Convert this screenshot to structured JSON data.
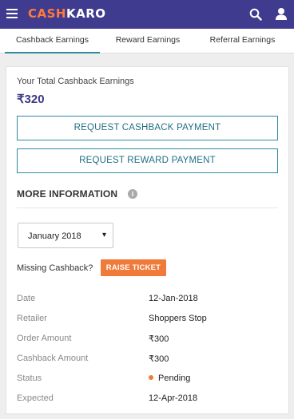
{
  "header": {
    "logo_part1": "CASH",
    "logo_part2": "KARO",
    "menu_icon": "hamburger-menu-icon",
    "search_icon": "search-icon",
    "user_icon": "user-icon"
  },
  "tabs": [
    {
      "label": "Cashback Earnings",
      "active": true
    },
    {
      "label": "Reward Earnings",
      "active": false
    },
    {
      "label": "Referral Earnings",
      "active": false
    }
  ],
  "summary": {
    "label": "Your Total Cashback Earnings",
    "amount": "₹320"
  },
  "buttons": {
    "request_cashback": "REQUEST CASHBACK PAYMENT",
    "request_reward": "REQUEST REWARD PAYMENT"
  },
  "more_info": {
    "title": "MORE INFORMATION",
    "icon": "i"
  },
  "month_select": {
    "value": "January 2018",
    "caret": "▾"
  },
  "missing": {
    "label": "Missing Cashback?",
    "button": "RAISE TICKET"
  },
  "details": [
    {
      "label": "Date",
      "value": "12-Jan-2018"
    },
    {
      "label": "Retailer",
      "value": "Shoppers Stop"
    },
    {
      "label": "Order Amount",
      "value": "₹300"
    },
    {
      "label": "Cashback Amount",
      "value": "₹300"
    },
    {
      "label": "Status",
      "value": "Pending"
    },
    {
      "label": "Expected",
      "value": "12-Apr-2018"
    }
  ],
  "colors": {
    "header_bg": "#3f3b8f",
    "accent_orange": "#ef7a3a",
    "teal": "#2f8aa0"
  }
}
